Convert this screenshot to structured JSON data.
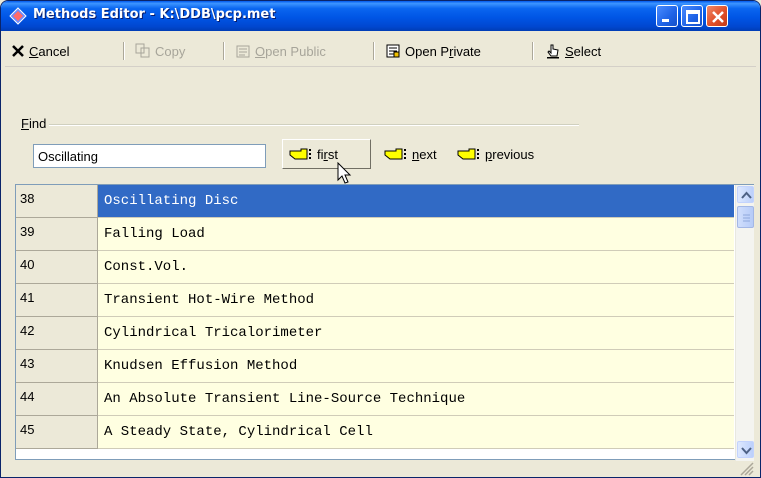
{
  "window": {
    "title": "Methods Editor - K:\\DDB\\pcp.met",
    "accent": "#0055e5",
    "close_color": "#e0502a"
  },
  "titlebar_buttons": {
    "minimize_icon": "minimize-icon",
    "maximize_icon": "maximize-icon",
    "close_icon": "close-icon"
  },
  "toolbar": {
    "cancel_underline": "C",
    "cancel_rest": "ancel",
    "copy_label": "Copy",
    "open_public_underline": "O",
    "open_public_rest": "pen Public",
    "open_private_before": "Open P",
    "open_private_underline": "r",
    "open_private_after": "ivate",
    "select_underline": "S",
    "select_rest": "elect"
  },
  "find": {
    "label_underline": "F",
    "label_rest": "ind",
    "value": "Oscillating",
    "first_before": "fi",
    "first_underline": "r",
    "first_after": "st",
    "next_underline": "n",
    "next_rest": "ext",
    "previous_underline": "p",
    "previous_rest": "revious"
  },
  "grid": {
    "selected_color": "#316ac5",
    "cell_bg": "#ffffe1",
    "rows": [
      {
        "id": "38",
        "name": "Oscillating Disc"
      },
      {
        "id": "39",
        "name": "Falling Load"
      },
      {
        "id": "40",
        "name": "Const.Vol."
      },
      {
        "id": "41",
        "name": "Transient Hot-Wire Method"
      },
      {
        "id": "42",
        "name": "Cylindrical Tricalorimeter"
      },
      {
        "id": "43",
        "name": "Knudsen Effusion Method"
      },
      {
        "id": "44",
        "name": "An Absolute Transient Line-Source Technique"
      },
      {
        "id": "45",
        "name": "A Steady State, Cylindrical Cell"
      }
    ]
  }
}
